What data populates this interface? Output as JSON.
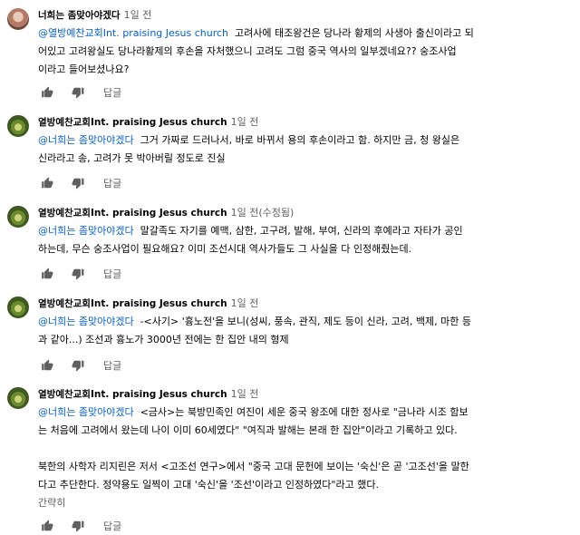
{
  "comments": [
    {
      "author": "너희는 좀맞아야겠다",
      "time": "1일 전",
      "mention": "@열방예찬교회Int. praising Jesus church",
      "lines": [
        "고려사에 태조왕건은 당나라 황제의 사생아 출신이라고 되",
        "어있고 고려왕실도 당나라황제의 후손을 자처했으니 고려도 그럼 중국 역사의 일부겠네요?? 숭조사업",
        "이라고 들어보셨나요?"
      ],
      "reply_label": "답글"
    },
    {
      "author": "열방예찬교회Int. praising Jesus church",
      "time": "1일 전",
      "mention": "@너희는 좀맞아야겠다",
      "lines": [
        "그거 가짜로 드러나서, 바로 바뀌서 용의 후손이라고 함. 하지만 금, 청 왕실은",
        "신라라고 송, 고려가 못 박아버릴 정도로 진실"
      ],
      "reply_label": "답글"
    },
    {
      "author": "열방예찬교회Int. praising Jesus church",
      "time": "1일 전(수정됨)",
      "mention": "@너희는 좀맞아야겠다",
      "lines": [
        "말갈족도 자기를 예맥, 삼한, 고구려, 발해, 부여, 신라의 후예라고 자타가 공인",
        "하는데, 무슨 숭조사업이 필요해요? 이미 조선시대 역사가들도 그 사실을 다 인정해줬는데."
      ],
      "reply_label": "답글"
    },
    {
      "author": "열방예찬교회Int. praising Jesus church",
      "time": "1일 전",
      "mention": "@너희는 좀맞아야겠다",
      "lines": [
        "-<사기> '흉노전'을 보니(성씨, 풍속, 관직, 제도 등이 신라, 고려, 백제, 마한 등",
        "과 같아...) 조선과 흉노가 3000년 전에는 한 집안 내의 형제"
      ],
      "reply_label": "답글"
    },
    {
      "author": "열방예찬교회Int. praising Jesus church",
      "time": "1일 전",
      "mention": "@너희는 좀맞아야겠다",
      "lines": [
        "<금사>는 북방민족인 여진이 세운 중국 왕조에 대한 정사로 \"금나라 시조 함보",
        "는 처음에 고려에서 왔는데 나이 이미 60세였다\" \"여직과 발해는 본래 한 집안\"이라고 기록하고 있다.",
        "",
        "북한의 사학자 리지린은 저서 <고조선 연구>에서 \"중국 고대 문헌에 보이는 '숙신'은 곧 '고조선'을 말한",
        "다고 추단한다. 정약용도 일찍이 고대 '숙신'을 '조선'이라고 인정하였다\"라고 했다."
      ],
      "more_label": "간략히",
      "reply_label": "답글"
    }
  ]
}
